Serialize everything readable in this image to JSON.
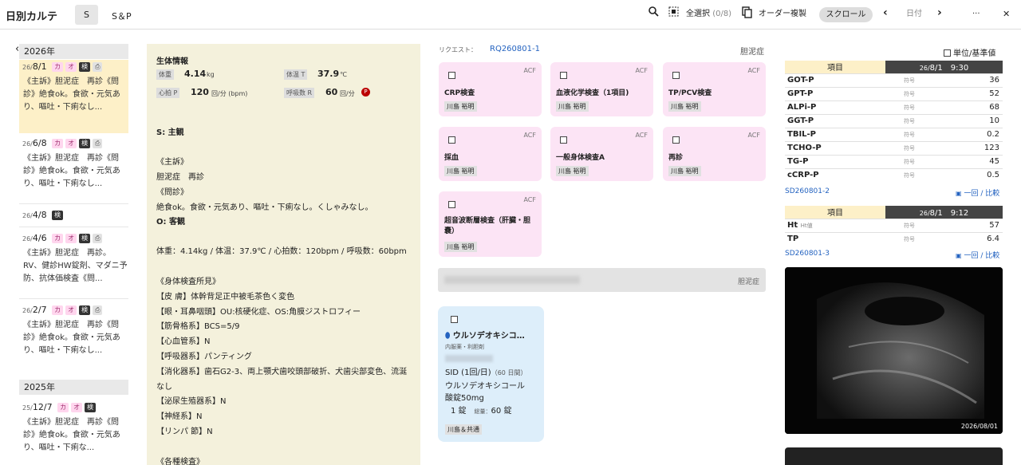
{
  "header": {
    "title": "日別カルテ",
    "tab_s": "S",
    "tab_sp": "S＆P",
    "select_all": "全選択",
    "select_count": "(0/8)",
    "copy_order": "オーダー複製",
    "scroll": "スクロール",
    "date": "日付",
    "more": "···",
    "close": "✕"
  },
  "timeline": {
    "year1": "2026年",
    "year2": "2025年",
    "entries": [
      {
        "yr": "26/",
        "date": "8/1",
        "badges": [
          "カ",
          "オ",
          "検",
          "clip"
        ],
        "text": "《主訴》胆泥症　再診《問診》絶食ok。食欲・元気あり、嘔吐・下痢なし..."
      },
      {
        "yr": "26/",
        "date": "6/8",
        "badges": [
          "カ",
          "オ",
          "検",
          "clip"
        ],
        "text": "《主訴》胆泥症　再診《問診》絶食ok。食欲・元気あり、嘔吐・下痢なし..."
      },
      {
        "yr": "26/",
        "date": "4/8",
        "badges": [
          "検"
        ],
        "text": ""
      },
      {
        "yr": "26/",
        "date": "4/6",
        "badges": [
          "カ",
          "オ",
          "検",
          "clip"
        ],
        "text": "《主訴》胆泥症　再診。RV、健診HW錠剤、マダニ予防、抗体価検査《問..."
      },
      {
        "yr": "26/",
        "date": "2/7",
        "badges": [
          "カ",
          "オ",
          "検",
          "clip"
        ],
        "text": "《主訴》胆泥症　再診《問診》絶食ok。食欲・元気あり、嘔吐・下痢なし..."
      },
      {
        "yr": "25/",
        "date": "12/7",
        "badges": [
          "カ",
          "オ",
          "検"
        ],
        "text": "《主訴》胆泥症　再診《問診》絶食ok。食欲・元気あり、嘔吐・下痢な..."
      }
    ]
  },
  "vitals": {
    "title": "生体情報",
    "weight_label": "体重",
    "weight": "4.14",
    "weight_unit": "kg",
    "temp_label": "体温 T",
    "temp": "37.9",
    "temp_unit": "℃",
    "pulse_label": "心拍 P",
    "pulse": "120",
    "pulse_unit": "回/分 (bpm)",
    "resp_label": "呼吸数 R",
    "resp": "60",
    "resp_unit": "回/分",
    "p_badge": "P"
  },
  "soap": {
    "s_title": "S: 主観",
    "s_body": "《主訴》\n胆泥症　再診\n《問診》\n絶食ok。食欲・元気あり、嘔吐・下痢なし。くしゃみなし。",
    "o_title": "O: 客観",
    "o_body": "体重：4.14kg / 体温：37.9℃ / 心拍数：120bpm / 呼吸数：60bpm\n\n《身体検査所見》\n【皮 膚】体幹背足正中被毛茶色く変色\n【眼・耳鼻咽頭】OU:核硬化症、OS:角膜ジストロフィー\n【筋骨格系】BCS=5/9\n【心血管系】N\n【呼吸器系】パンティング\n【消化器系】歯石G2-3、両上顎犬歯咬頭部破折、犬歯尖部変色、流涎なし\n【泌尿生殖器系】N\n【神経系】N\n【リンパ 節】N\n\n《各種検査》"
  },
  "requests": {
    "label": "リクエスト：",
    "id": "RQ260801-1",
    "diagnosis": "胆泥症",
    "acf": "ACF",
    "doctor": "川島 裕明",
    "cards": [
      {
        "name": "CRP検査"
      },
      {
        "name": "血液化学検査（1項目)"
      },
      {
        "name": "TP/PCV検査"
      },
      {
        "name": "採血"
      },
      {
        "name": "一般身体検査A"
      },
      {
        "name": "再診"
      },
      {
        "name": "超音波断層検査（肝臓・胆嚢）"
      }
    ],
    "second_diagnosis": "胆泥症"
  },
  "medication": {
    "name": "ウルソデオキシコ…",
    "category": "内服薬・利胆剤",
    "dose": "SID (1回/日)",
    "days": "（60 日間）",
    "drug1": "ウルソデオキシコール",
    "drug2": "酸錠50mg",
    "qty": "1 錠",
    "total_label": "総量：",
    "total": "60 錠",
    "doctor": "川島＆共通"
  },
  "results": {
    "unit_check": "単位/基準値",
    "item_header": "項目",
    "sign": "符号",
    "table1": {
      "date_yr": "26/",
      "date": "8/1",
      "time": "9:30",
      "rows": [
        {
          "name": "GOT-P",
          "value": "36"
        },
        {
          "name": "GPT-P",
          "value": "52"
        },
        {
          "name": "ALPi-P",
          "value": "68"
        },
        {
          "name": "GGT-P",
          "value": "10"
        },
        {
          "name": "TBIL-P",
          "value": "0.2"
        },
        {
          "name": "TCHO-P",
          "value": "123"
        },
        {
          "name": "TG-P",
          "value": "45"
        },
        {
          "name": "cCRP-P",
          "value": "0.5"
        }
      ],
      "link": "SD260801-2"
    },
    "table2": {
      "date_yr": "26/",
      "date": "8/1",
      "time": "9:12",
      "rows": [
        {
          "name": "Ht",
          "sub": "Ht値",
          "value": "57"
        },
        {
          "name": "TP",
          "sub": "",
          "value": "6.4"
        }
      ],
      "link": "SD260801-3"
    },
    "one_time": "一回",
    "compare": "比較",
    "image_date": "2026/08/01"
  }
}
